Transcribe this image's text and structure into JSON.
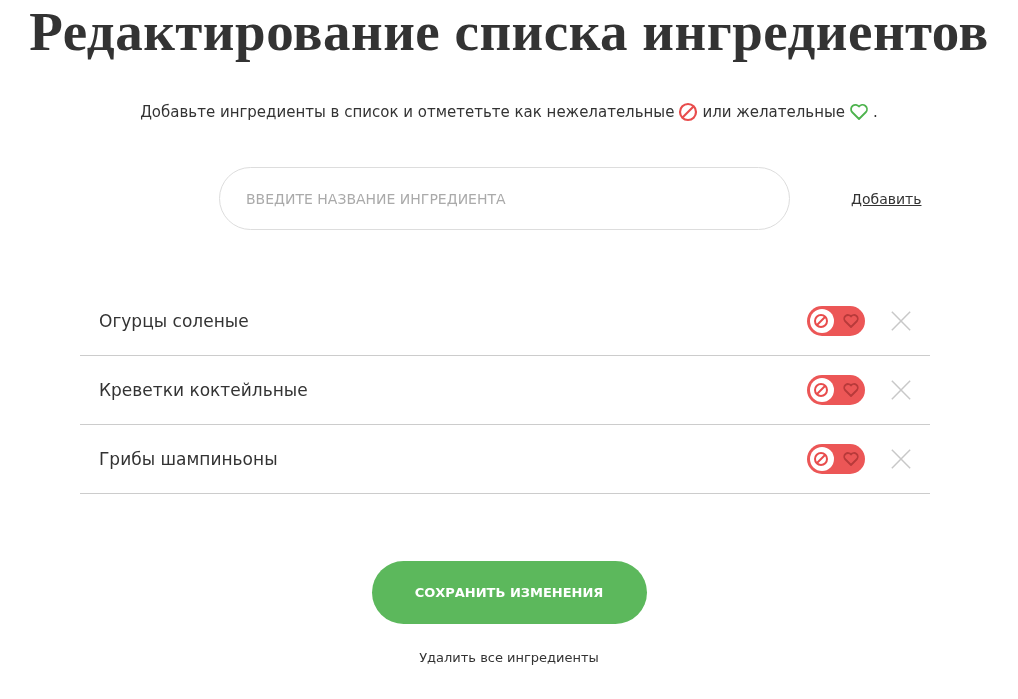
{
  "title": "Редактирование списка ингредиентов",
  "intro": {
    "before": "Добавьте ингредиенты в список и отмететьте как нежелательные",
    "middle": "или желательные",
    "after": "."
  },
  "search": {
    "placeholder": "ВВЕДИТЕ НАЗВАНИЕ ИНГРЕДИЕНТА"
  },
  "add_link": "Добавить",
  "ingredients": [
    {
      "name": "Огурцы соленые",
      "wanted": false
    },
    {
      "name": "Креветки коктейльные",
      "wanted": false
    },
    {
      "name": "Грибы шампиньоны",
      "wanted": false
    }
  ],
  "save_button": "СОХРАНИТЬ ИЗМЕНЕНИЯ",
  "delete_all": "Удалить все ингредиенты"
}
